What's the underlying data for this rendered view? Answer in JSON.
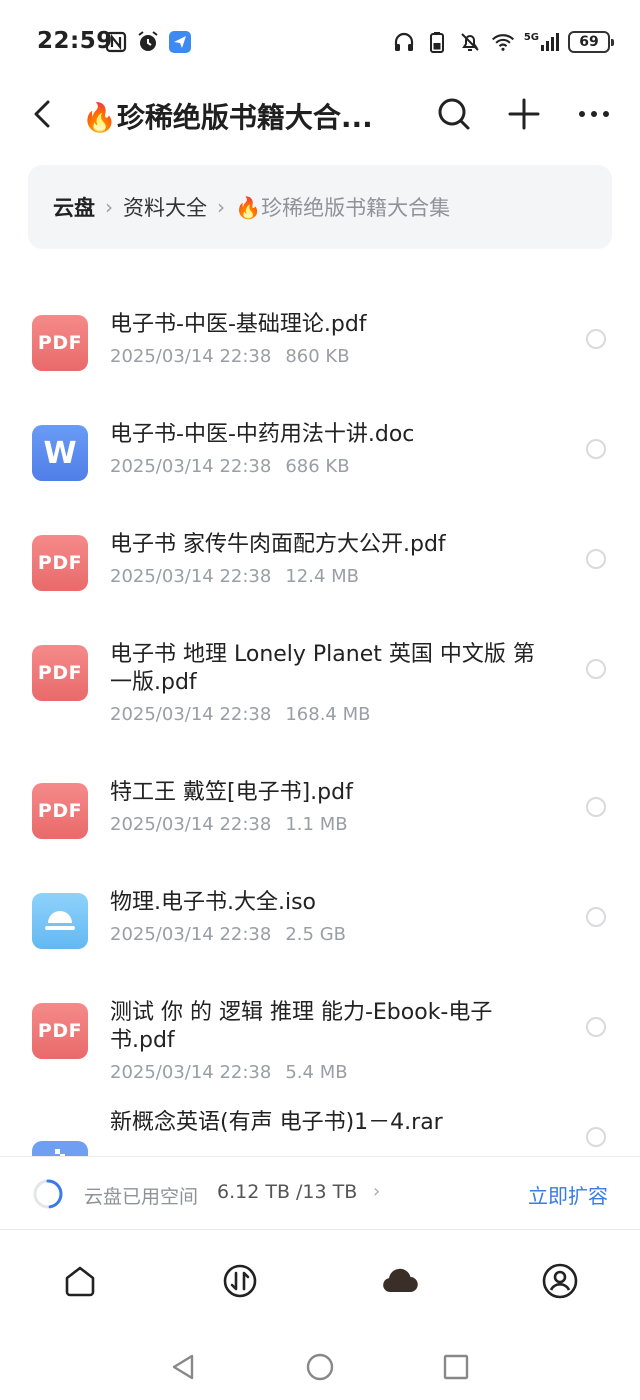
{
  "status_bar": {
    "time": "22:59",
    "left_icons": [
      "nfc-icon",
      "alarm-icon",
      "app-notification-icon"
    ],
    "right_icons": [
      "headphones-icon",
      "battery-saver-icon",
      "mute-icon",
      "wifi-icon",
      "signal-5g-icon"
    ],
    "network": "5G",
    "battery": "69"
  },
  "header": {
    "title": "🔥珍稀绝版书籍大合...",
    "back_icon": "chevron-left-icon",
    "actions": [
      "search-icon",
      "plus-icon",
      "more-icon"
    ]
  },
  "breadcrumb": {
    "root": "云盘",
    "middle": "资料大全",
    "current": "🔥珍稀绝版书籍大合集"
  },
  "files": [
    {
      "name": "电子书-中医-基础理论.pdf",
      "date": "2025/03/14 22:38",
      "size": "860 KB",
      "type": "pdf",
      "icon_label": "PDF"
    },
    {
      "name": "电子书-中医-中药用法十讲.doc",
      "date": "2025/03/14 22:38",
      "size": "686 KB",
      "type": "word",
      "icon_label": "W"
    },
    {
      "name": "电子书 家传牛肉面配方大公开.pdf",
      "date": "2025/03/14 22:38",
      "size": "12.4 MB",
      "type": "pdf",
      "icon_label": "PDF"
    },
    {
      "name": "电子书 地理 Lonely Planet 英国 中文版 第一版.pdf",
      "date": "2025/03/14 22:38",
      "size": "168.4 MB",
      "type": "pdf",
      "icon_label": "PDF"
    },
    {
      "name": "特工王 戴笠[电子书].pdf",
      "date": "2025/03/14 22:38",
      "size": "1.1 MB",
      "type": "pdf",
      "icon_label": "PDF"
    },
    {
      "name": "物理.电子书.大全.iso",
      "date": "2025/03/14 22:38",
      "size": "2.5 GB",
      "type": "iso",
      "icon_label": ""
    },
    {
      "name": "测试 你 的 逻辑 推理 能力-Ebook-电子书.pdf",
      "date": "2025/03/14 22:38",
      "size": "5.4 MB",
      "type": "pdf",
      "icon_label": "PDF"
    },
    {
      "name": "新概念英语(有声 电子书)1－4.rar",
      "date": "",
      "size": "",
      "type": "rar",
      "icon_label": ""
    }
  ],
  "storage": {
    "label": "云盘已用空间",
    "value": "6.12 TB /13 TB",
    "chevron": "›",
    "action": "立即扩容",
    "used_fraction": 0.47
  },
  "bottom_nav": [
    "home-icon",
    "transfer-icon",
    "cloud-icon",
    "profile-icon"
  ],
  "system_nav": [
    "back-triangle-icon",
    "home-circle-icon",
    "recent-square-icon"
  ],
  "colors": {
    "accent": "#3b7be6",
    "pdf": "#ee7272",
    "word": "#5585ec",
    "iso": "#7cc7f7",
    "meta_text": "#9a9ea5"
  }
}
